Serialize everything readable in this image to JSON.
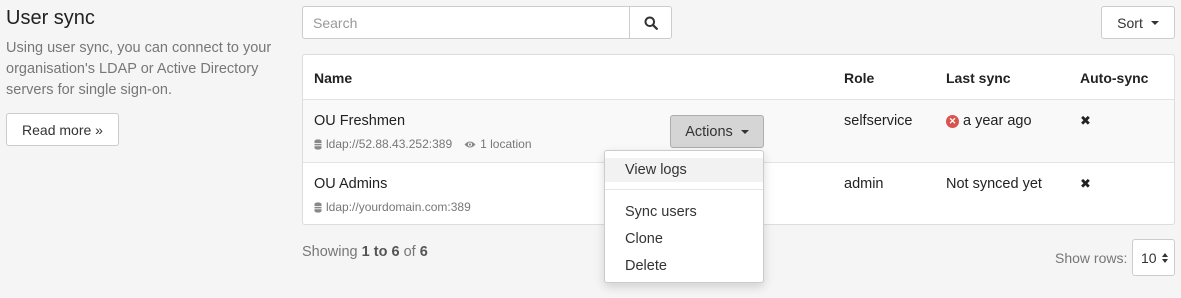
{
  "sidebar": {
    "title": "User sync",
    "description": "Using user sync, you can connect to your organisation's LDAP or Active Directory servers for single sign-on.",
    "read_more_label": "Read more »"
  },
  "search": {
    "placeholder": "Search",
    "value": ""
  },
  "sort": {
    "label": "Sort"
  },
  "table": {
    "columns": [
      "Name",
      "Role",
      "Last sync",
      "Auto-sync"
    ],
    "rows": [
      {
        "name": "OU Freshmen",
        "url": "ldap://52.88.43.252:389",
        "locations": "1 location",
        "role": "selfservice",
        "last_sync": "a year ago",
        "last_sync_status": "error",
        "auto_sync": "✖"
      },
      {
        "name": "OU Admins",
        "url": "ldap://yourdomain.com:389",
        "role": "admin",
        "last_sync": "Not synced yet",
        "auto_sync": "✖"
      }
    ]
  },
  "actions": {
    "label": "Actions",
    "menu": [
      "View logs",
      "Sync users",
      "Clone",
      "Delete"
    ]
  },
  "pagination": {
    "prefix": "Showing",
    "range": "1 to 6",
    "of": "of",
    "total": "6",
    "rows_label": "Show rows:",
    "rows_value": "10"
  },
  "colors": {
    "error": "#d9534f",
    "active_button": "#d5d5d5"
  }
}
